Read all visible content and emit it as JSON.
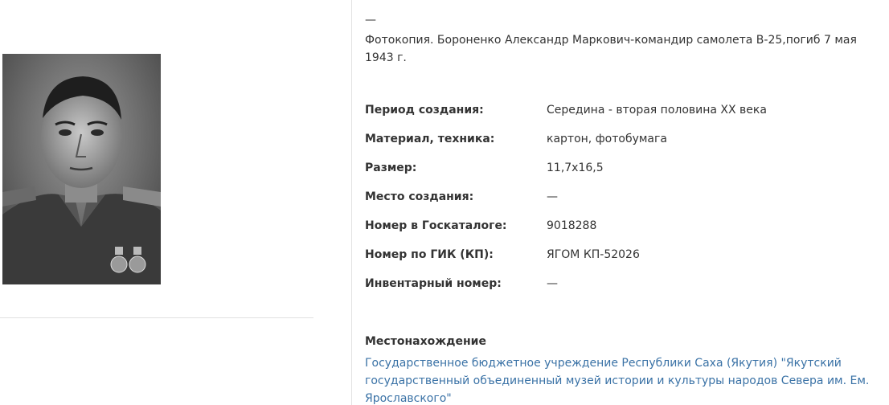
{
  "exhibit": {
    "photo_icon": "portrait-photo",
    "description_dash": "—",
    "description": "Фотокопия. Бороненко Александр Маркович-командир самолета В-25,погиб 7 мая 1943 г.",
    "attributes": [
      {
        "label": "Период создания:",
        "value": "Середина - вторая половина XX века"
      },
      {
        "label": "Материал, техника:",
        "value": "картон, фотобумага"
      },
      {
        "label": "Размер:",
        "value": "11,7x16,5"
      },
      {
        "label": "Место создания:",
        "value": "—"
      },
      {
        "label": "Номер в Госкаталоге:",
        "value": "9018288"
      },
      {
        "label": "Номер по ГИК (КП):",
        "value": "ЯГОМ КП-52026"
      },
      {
        "label": "Инвентарный номер:",
        "value": "—"
      }
    ],
    "location": {
      "heading": "Местонахождение",
      "link_text": "Государственное бюджетное учреждение Республики Саха (Якутия) \"Якутский государственный объединенный музей истории и культуры народов Севера им. Ем. Ярославского\""
    }
  },
  "colors": {
    "link": "#3a72a6",
    "text": "#333333",
    "divider": "#e2e2e2"
  }
}
